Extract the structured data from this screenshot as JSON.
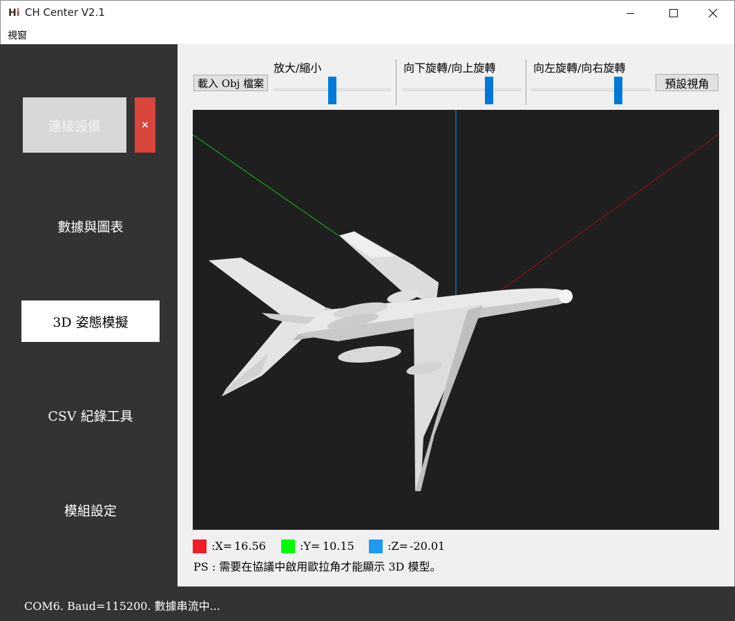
{
  "window": {
    "title": "CH Center V2.1",
    "icon": "hi-logo-icon"
  },
  "menu": {
    "view_label": "視窗"
  },
  "sidebar": {
    "connect_label": "連接設備",
    "close_label": "×",
    "items": [
      {
        "label": "數據與圖表"
      },
      {
        "label": "3D 姿態模擬",
        "active": true
      },
      {
        "label": "CSV 紀錄工具"
      },
      {
        "label": "模組設定"
      }
    ]
  },
  "toolbar": {
    "load_obj_label": "載入 Obj 檔案",
    "zoom_label": "放大/縮小",
    "pitch_label": "向下旋轉/向上旋轉",
    "yaw_label": "向左旋轉/向右旋轉",
    "reset_view_label": "預設視角"
  },
  "sliders": {
    "zoom_value": 0.5,
    "pitch_value": 0.73,
    "yaw_value": 0.73
  },
  "legend": {
    "x_label": ":X=",
    "x_value": "16.56",
    "y_label": ":Y=",
    "y_value": "10.15",
    "z_label": ":Z=",
    "z_value": "-20.01",
    "x_color": "#ee1c25",
    "y_color": "#00ff00",
    "z_color": "#1e9bf0"
  },
  "note": "PS : 需要在協議中啟用歐拉角才能顯示 3D 模型。",
  "status": "COM6. Baud=115200. 數據串流中...",
  "colors": {
    "sidebar_bg": "#333333",
    "viewport_bg": "#1f1f1f",
    "slider_accent": "#0078d7",
    "close_button": "#d9443d"
  }
}
